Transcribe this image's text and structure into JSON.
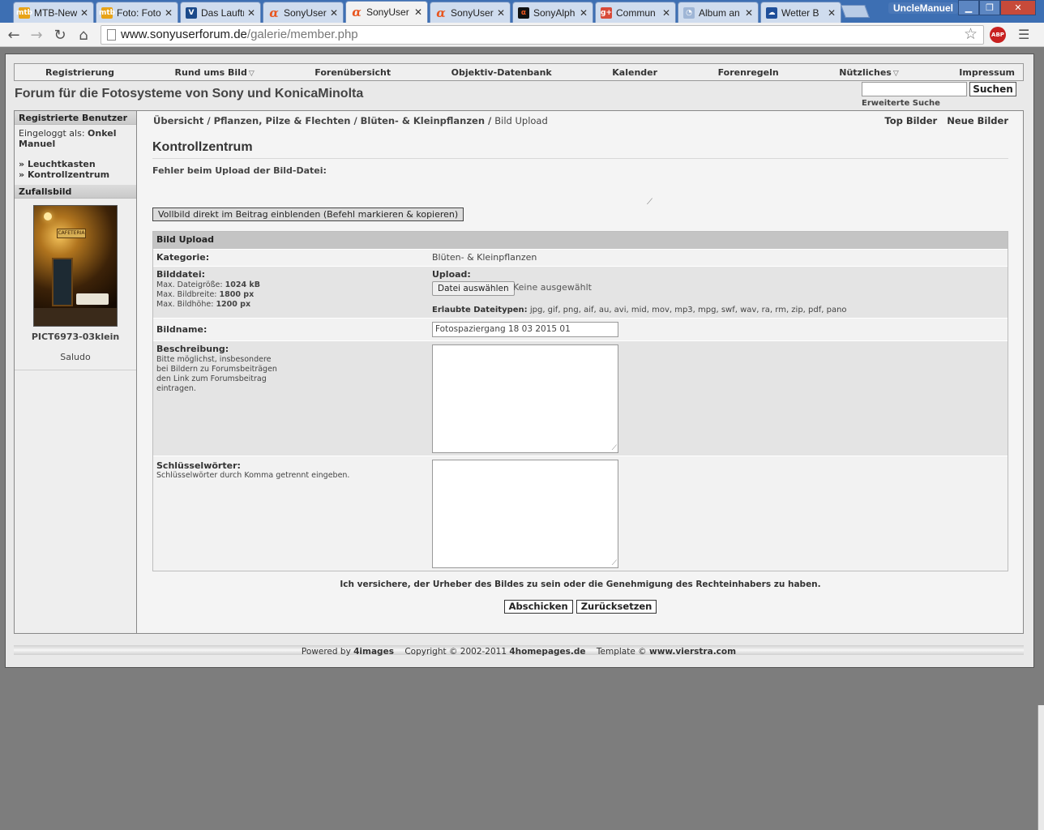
{
  "browser": {
    "tabs": [
      {
        "title": "MTB-News",
        "icon": "mtb-news-icon",
        "fav": "mtb"
      },
      {
        "title": "Foto: Foto",
        "icon": "mtb-news-icon",
        "fav": "mtb"
      },
      {
        "title": "Das Lauftr",
        "icon": "lauf-icon",
        "fav": "lauf"
      },
      {
        "title": "SonyUser",
        "icon": "alpha-icon",
        "fav": "alpha"
      },
      {
        "title": "SonyUser",
        "icon": "alpha-icon",
        "fav": "alpha"
      },
      {
        "title": "SonyUser",
        "icon": "alpha-icon",
        "fav": "alpha"
      },
      {
        "title": "SonyAlph",
        "icon": "alpha-icon",
        "fav": "black"
      },
      {
        "title": "Commun",
        "icon": "google-plus-icon",
        "fav": "gplus"
      },
      {
        "title": "Album an",
        "icon": "album-icon",
        "fav": "album"
      },
      {
        "title": "Wetter B",
        "icon": "wetter-icon",
        "fav": "wetter"
      }
    ],
    "user": "UncleManuel",
    "url_host": "www.sonyuserforum.de",
    "url_path": "/galerie/member.php",
    "abp_label": "ABP"
  },
  "site": {
    "nav": [
      "Registrierung",
      "Rund ums Bild",
      "Forenübersicht",
      "Objektiv-Datenbank",
      "Kalender",
      "Forenregeln",
      "Nützliches",
      "Impressum"
    ],
    "title": "Forum für die Fotosysteme von Sony und KonicaMinolta",
    "search_button": "Suchen",
    "advanced_search": "Erweiterte Suche"
  },
  "sidebar": {
    "registered_head": "Registrierte Benutzer",
    "logged_in_label": "Eingeloggt als:",
    "logged_in_user": "Onkel Manuel",
    "links": [
      "Leuchtkasten",
      "Kontrollzentrum"
    ],
    "random_head": "Zufallsbild",
    "thumb_sign": "CAFETERIA",
    "thumb_caption": "PICT6973-03klein",
    "thumb_user": "Saludo"
  },
  "content": {
    "breadcrumbs": [
      "Übersicht",
      "Pflanzen, Pilze & Flechten",
      "Blüten- & Kleinpflanzen"
    ],
    "breadcrumb_current": "Bild Upload",
    "top_links": [
      "Top Bilder",
      "Neue Bilder"
    ],
    "heading": "Kontrollzentrum",
    "error": "Fehler beim Upload der Bild-Datei:",
    "vollbild_button": "Vollbild direkt im Beitrag einblenden (Befehl markieren & kopieren)",
    "form_head": "Bild Upload",
    "category_label": "Kategorie:",
    "category_value": "Blüten- & Kleinpflanzen",
    "file_label": "Bilddatei:",
    "file_limits": [
      {
        "label": "Max. Dateigröße:",
        "value": "1024 kB"
      },
      {
        "label": "Max. Bildbreite:",
        "value": "1800 px"
      },
      {
        "label": "Max. Bildhöhe:",
        "value": "1200 px"
      }
    ],
    "upload_label": "Upload:",
    "file_button": "Datei auswählen",
    "file_none": "Keine ausgewählt",
    "allowed_label": "Erlaubte Dateitypen:",
    "allowed_types": "jpg, gif, png, aif, au, avi, mid, mov, mp3, mpg, swf, wav, ra, rm, zip, pdf, pano",
    "name_label": "Bildname:",
    "name_value": "Fotospaziergang 18 03 2015 01",
    "desc_label": "Beschreibung:",
    "desc_hint": [
      "Bitte möglichst, insbesondere",
      "bei Bildern zu Forumsbeiträgen",
      "den Link zum Forumsbeitrag",
      "eintragen."
    ],
    "keywords_label": "Schlüsselwörter:",
    "keywords_hint": "Schlüsselwörter durch Komma getrennt eingeben.",
    "consent": "Ich versichere, der Urheber des Bildes zu sein oder die Genehmigung des Rechteinhabers zu haben.",
    "submit": "Abschicken",
    "reset": "Zurücksetzen"
  },
  "footer": {
    "powered_label": "Powered by",
    "powered_value": "4images",
    "copyright_label": "Copyright © 2002-2011",
    "copyright_value": "4homepages.de",
    "template_label": "Template ©",
    "template_value": "www.vierstra.com"
  }
}
